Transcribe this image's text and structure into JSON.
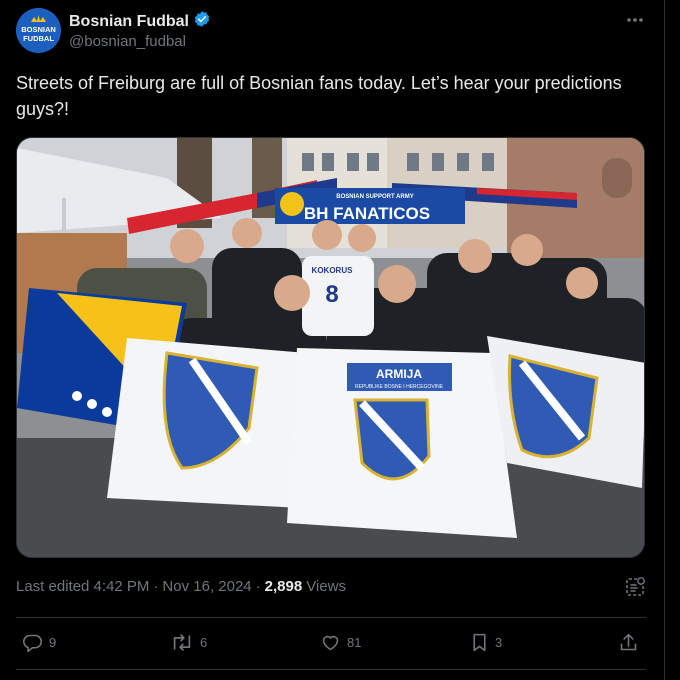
{
  "author": {
    "display_name": "Bosnian Fudbal",
    "handle": "@bosnian_fudbal",
    "avatar_text_line1": "BOSNIAN",
    "avatar_text_line2": "FUDBAL",
    "verified": true
  },
  "tweet": {
    "text": "Streets of Freiburg are full of Bosnian fans today. Let’s hear your predictions guys?!"
  },
  "media": {
    "banner_text": "BH FANATICOS",
    "banner_small": "BOSNIAN SUPPORT ARMY",
    "jersey_name": "KOKORUS",
    "jersey_number": "8",
    "flag_text": "ARMIJA",
    "flag_subtext": "REPUBLIKE BOSNE I HERCEGOVINE"
  },
  "meta": {
    "edited_label": "Last edited 4:42 PM",
    "separator": "·",
    "date": "Nov 16, 2024",
    "views_count": "2,898",
    "views_label": "Views"
  },
  "actions": {
    "replies": "9",
    "reposts": "6",
    "likes": "81",
    "bookmarks": "3"
  },
  "colors": {
    "background": "#000000",
    "text": "#e7e9ea",
    "muted": "#71767b",
    "border": "#2f3336",
    "verified": "#1d9bf0"
  }
}
